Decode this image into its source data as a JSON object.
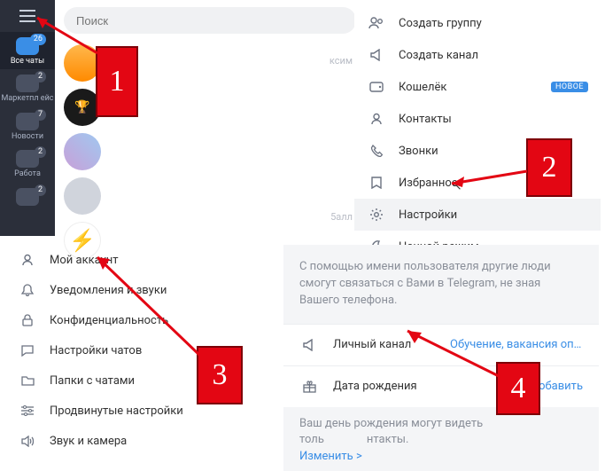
{
  "search": {
    "placeholder": "Поиск"
  },
  "rail": {
    "items": [
      {
        "label": "Все чаты",
        "badge": "26"
      },
      {
        "label": "Маркетпл\nейс",
        "badge": "2"
      },
      {
        "label": "Новости",
        "badge": "7"
      },
      {
        "label": "Работа",
        "badge": "2"
      },
      {
        "label": "",
        "badge": "2"
      }
    ]
  },
  "chat_meta": {
    "top": "ксим",
    "bottom": "5алл"
  },
  "menu": {
    "items": [
      {
        "label": "Создать группу"
      },
      {
        "label": "Создать канал"
      },
      {
        "label": "Кошелёк",
        "tag": "НОВОЕ"
      },
      {
        "label": "Контакты"
      },
      {
        "label": "Звонки"
      },
      {
        "label": "Избранное"
      },
      {
        "label": "Настройки"
      },
      {
        "label": "Ночной режим"
      }
    ]
  },
  "settings": {
    "items": [
      {
        "label": "Мой аккаунт"
      },
      {
        "label": "Уведомления и звуки"
      },
      {
        "label": "Конфиденциальность"
      },
      {
        "label": "Настройки чатов"
      },
      {
        "label": "Папки с чатами"
      },
      {
        "label": "Продвинутые настройки"
      },
      {
        "label": "Звук и камера"
      }
    ]
  },
  "detail": {
    "username_hint": "С помощью имени пользователя другие люди смогут связаться с Вами в Telegram, не зная Вашего телефона.",
    "channel_label": "Личный канал",
    "channel_value": "Обучение, вакансия опе…",
    "birthday_label": "Дата рождения",
    "birthday_action": "Добавить",
    "birthday_hint": "Ваш день рождения могут видеть толь",
    "birthday_hint2": "нтакты.",
    "change_link": "Изменить >"
  },
  "anno": {
    "n1": "1",
    "n2": "2",
    "n3": "3",
    "n4": "4"
  }
}
